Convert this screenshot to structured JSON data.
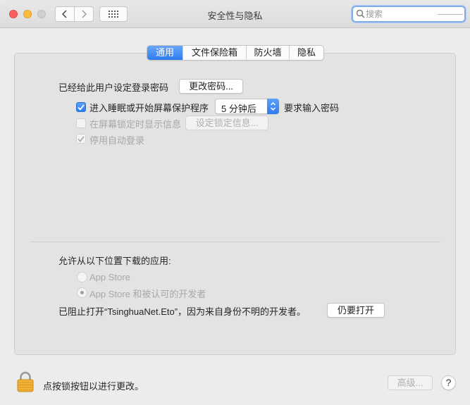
{
  "window": {
    "title": "安全性与隐私",
    "search_placeholder": "搜索"
  },
  "tabs": [
    {
      "label": "通用",
      "active": true
    },
    {
      "label": "文件保险箱",
      "active": false
    },
    {
      "label": "防火墙",
      "active": false
    },
    {
      "label": "隐私",
      "active": false
    }
  ],
  "general": {
    "password_set_label": "已经给此用户设定登录密码",
    "change_password_button": "更改密码...",
    "sleep_checkbox_label": "进入睡眠或开始屏幕保护程序",
    "sleep_checkbox_checked": true,
    "delay_value": "5 分钟后",
    "require_password_label": "要求输入密码",
    "lock_message_label": "在屏幕锁定时显示信息",
    "lock_message_checked": false,
    "set_lock_message_button": "设定锁定信息...",
    "disable_autologin_label": "停用自动登录",
    "disable_autologin_checked": true
  },
  "downloads": {
    "title": "允许从以下位置下载的应用:",
    "options": [
      {
        "label": "App Store",
        "selected": false
      },
      {
        "label": "App Store 和被认可的开发者",
        "selected": true
      }
    ],
    "blocked_message": "已阻止打开“TsinghuaNet.Eto”，因为来自身份不明的开发者。",
    "open_anyway_button": "仍要打开"
  },
  "footer": {
    "lock_text": "点按锁按钮以进行更改。",
    "advanced_button": "高级...",
    "help_label": "?"
  },
  "colors": {
    "accent": "#2f7cf0",
    "window_bg": "#ececec",
    "panel_bg": "#e3e3e3"
  }
}
